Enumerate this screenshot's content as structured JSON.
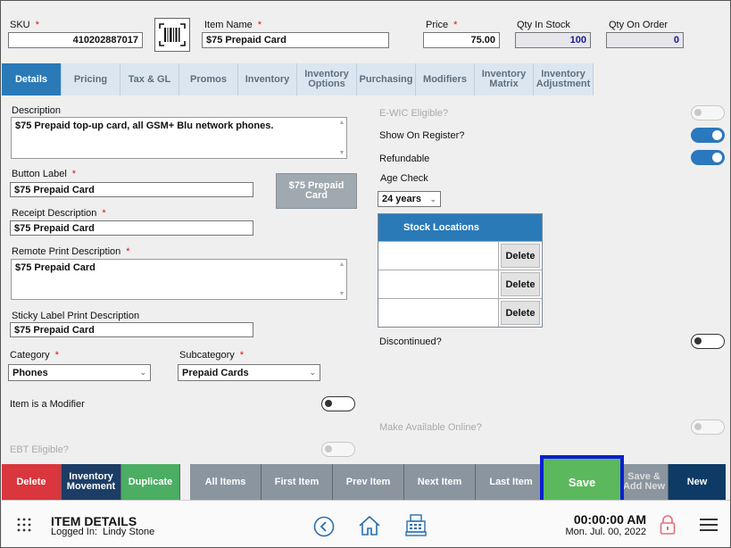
{
  "header": {
    "sku_label": "SKU",
    "sku_value": "410202887017",
    "item_name_label": "Item Name",
    "item_name_value": "$75 Prepaid Card",
    "price_label": "Price",
    "price_value": "75.00",
    "qty_stock_label": "Qty In Stock",
    "qty_stock_value": "100",
    "qty_order_label": "Qty On Order",
    "qty_order_value": "0",
    "required_mark": "*"
  },
  "tabs": [
    {
      "label": "Details",
      "active": true
    },
    {
      "label": "Pricing"
    },
    {
      "label": "Tax & GL"
    },
    {
      "label": "Promos"
    },
    {
      "label": "Inventory"
    },
    {
      "label": "Inventory Options"
    },
    {
      "label": "Purchasing"
    },
    {
      "label": "Modifiers"
    },
    {
      "label": "Inventory Matrix"
    },
    {
      "label": "Inventory Adjustment"
    }
  ],
  "details": {
    "description_label": "Description",
    "description_value": "$75 Prepaid top-up card, all GSM+ Blu network phones.",
    "button_label_label": "Button Label",
    "button_label_value": "$75 Prepaid Card",
    "button_preview": "$75 Prepaid Card",
    "receipt_desc_label": "Receipt Description",
    "receipt_desc_value": "$75 Prepaid Card",
    "remote_print_label": "Remote Print Description",
    "remote_print_value": "$75 Prepaid Card",
    "sticky_label_label": "Sticky Label Print Description",
    "sticky_label_value": "$75 Prepaid Card",
    "category_label": "Category",
    "category_value": "Phones",
    "subcategory_label": "Subcategory",
    "subcategory_value": "Prepaid Cards",
    "modifier_label": "Item is a Modifier",
    "ebt_label": "EBT Eligible?"
  },
  "right_panel": {
    "ewic_label": "E-WIC Eligible?",
    "show_register_label": "Show On Register?",
    "refundable_label": "Refundable",
    "age_check_label": "Age Check",
    "age_check_value": "24 years",
    "stock_locations_header": "Stock Locations",
    "delete_label": "Delete",
    "discontinued_label": "Discontinued?",
    "online_label": "Make Available Online?"
  },
  "actions": {
    "delete": "Delete",
    "inventory_movement": "Inventory Movement",
    "duplicate": "Duplicate",
    "all_items": "All Items",
    "first_item": "First Item",
    "prev_item": "Prev Item",
    "next_item": "Next Item",
    "last_item": "Last Item",
    "save": "Save",
    "save_add_new": "Save & Add New",
    "new": "New"
  },
  "footer": {
    "title": "ITEM DETAILS",
    "logged_in_label": "Logged In:",
    "user": "Lindy Stone",
    "time": "00:00:00 AM",
    "date": "Mon. Jul. 00, 2022"
  },
  "colors": {
    "accent": "#2a7ab8",
    "delete": "#d9363e",
    "inventory_movement": "#1c3d66",
    "duplicate": "#4bae62",
    "nav_gray": "#8a959f",
    "save": "#5cb85c",
    "save_highlight": "#0a1fd1",
    "new": "#0d3b66"
  }
}
